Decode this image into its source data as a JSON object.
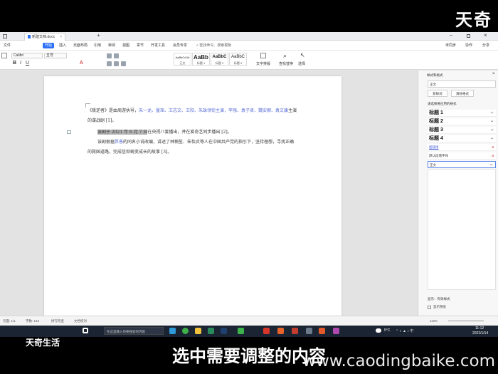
{
  "overlay": {
    "brand_top": "天奇",
    "brand_bottom": "天奇生活",
    "subtitle": "选中需要调整的内容",
    "watermark": "www.caodingbaike.com"
  },
  "tabs": {
    "doc_tab": "新建文档.docx"
  },
  "menu": {
    "items": [
      "文件",
      "开始",
      "插入",
      "页面布局",
      "引用",
      "审阅",
      "视图",
      "章节",
      "开发工具",
      "会员专享"
    ],
    "active_index": 1,
    "search": "查找命令、搜索模板",
    "right_items": [
      "未同步",
      "协作",
      "分享"
    ]
  },
  "ribbon": {
    "font_name": "Calibri",
    "font_size": "五号",
    "styles": [
      {
        "preview": "AaBbCcDd",
        "name": "正文"
      },
      {
        "preview": "AaBb",
        "name": "标题 1"
      },
      {
        "preview": "AaBbC",
        "name": "标题 2"
      },
      {
        "preview": "AaBbC",
        "name": "标题 3"
      }
    ],
    "text_tools": "文字排版",
    "find_replace": "查找替换",
    "select": "选择"
  },
  "document": {
    "para1_prefix": "《叛逆者》是由周游执导，",
    "para1_link1": "朱一龙、童瑶、王志文、王阳、朱珠领衔主演，",
    "para1_link2": "李强、袁子贤、",
    "para1_link3": "魏安娜、袁文康",
    "para1_suffix": "主演的谍战剧 [1]。",
    "para2_selected": "该剧于 2021 年 6 月 7 日",
    "para2_rest": "在央视八套播出，并在爱奇艺同步播出 [2]。",
    "para3_prefix": "该剧根据",
    "para3_link": "畀愚",
    "para3_suffix": "的同名小说改编，讲述了林楠笙、朱怡贞等人在中国共产党的指引下，坚持理想，寻找正确的救国道路，完成信仰蜕变成长的故事 [3]。"
  },
  "panel": {
    "title": "样式和格式",
    "current_style": "正文",
    "new_style": "新样式",
    "clear_format": "清除格式",
    "prompt": "请选择要应用的格式",
    "styles": [
      {
        "name": "标题 1",
        "kind": "heading"
      },
      {
        "name": "标题 2",
        "kind": "heading"
      },
      {
        "name": "标题 3",
        "kind": "heading"
      },
      {
        "name": "标题 4",
        "kind": "heading"
      },
      {
        "name": "超链接",
        "kind": "link"
      },
      {
        "name": "默认段落字体",
        "kind": "plain"
      },
      {
        "name": "正文",
        "kind": "plain"
      }
    ],
    "show_label": "显示：有效样式",
    "preview_label": "显示预览"
  },
  "status": {
    "page": "页面: 1/1",
    "words": "字数: 143",
    "spell": "拼写检查",
    "text_check": "文档校对",
    "zoom": "110%"
  },
  "taskbar": {
    "search_placeholder": "在这里输入你要搜索的内容",
    "weather": "5°C",
    "time": "11:12",
    "date": "2022/1/14"
  },
  "colors": {
    "accent": "#2b6ff6",
    "link": "#5b6fd6",
    "selection": "#b3b3b3",
    "taskbar": "#1b2432"
  }
}
